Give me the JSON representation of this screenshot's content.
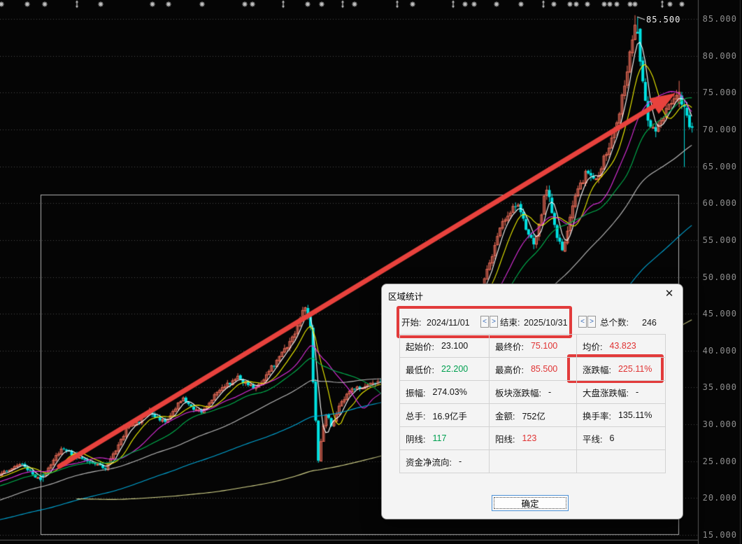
{
  "chart_data": {
    "type": "candlestick",
    "title": "daily K-line chart with area statistics selection",
    "y_axis": {
      "ticks": [
        "85.000",
        "80.000",
        "75.000",
        "70.000",
        "65.000",
        "60.000",
        "55.000",
        "50.000",
        "45.000",
        "40.000",
        "35.000",
        "30.000",
        "25.000",
        "20.000",
        "15.000"
      ],
      "min": 15,
      "max": 85
    },
    "peak_annotation": "85.500",
    "selection": {
      "start_date": "2024/11/01",
      "end_date": "2025/10/31",
      "bar_count": 246,
      "start_price": "23.100",
      "final_price": "75.100",
      "low": "22.200",
      "high": "85.500",
      "avg": "43.823",
      "change_pct": "225.11%"
    },
    "moving_averages": [
      {
        "period": 5,
        "color": "#ffffff"
      },
      {
        "period": 10,
        "color": "#f0f000"
      },
      {
        "period": 20,
        "color": "#e030e0"
      },
      {
        "period": 30,
        "color": "#00b450"
      },
      {
        "period": 60,
        "color": "#bebebe"
      },
      {
        "period": 120,
        "color": "#00a8d8"
      },
      {
        "period": 250,
        "color": "#d6d68c"
      }
    ],
    "prehistory_anchors": [
      [
        -220,
        26.5
      ],
      [
        -185,
        25
      ],
      [
        -150,
        20
      ],
      [
        -130,
        15
      ],
      [
        -110,
        13.5
      ],
      [
        -80,
        14.5
      ],
      [
        -50,
        17
      ],
      [
        -25,
        20.5
      ]
    ],
    "price_path_anchors": [
      [
        0,
        23.3
      ],
      [
        4,
        24.2
      ],
      [
        8,
        24.6
      ],
      [
        12,
        23.2
      ],
      [
        15,
        22.5
      ],
      [
        19,
        24.5
      ],
      [
        23,
        26.8
      ],
      [
        27,
        26
      ],
      [
        31,
        25.3
      ],
      [
        36,
        24.8
      ],
      [
        40,
        24.1
      ],
      [
        44,
        26.5
      ],
      [
        48,
        29.3
      ],
      [
        53,
        30.5
      ],
      [
        57,
        31.8
      ],
      [
        60,
        30.8
      ],
      [
        63,
        30.4
      ],
      [
        66,
        31.8
      ],
      [
        70,
        33.6
      ],
      [
        73,
        32.3
      ],
      [
        77,
        31.6
      ],
      [
        80,
        33
      ],
      [
        84,
        34.8
      ],
      [
        88,
        35.6
      ],
      [
        91,
        36.3
      ],
      [
        95,
        35.4
      ],
      [
        98,
        34.9
      ],
      [
        102,
        36.8
      ],
      [
        106,
        38.6
      ],
      [
        110,
        40.5
      ],
      [
        113,
        42.5
      ],
      [
        116,
        45.5
      ],
      [
        117,
        46.2
      ],
      [
        119,
        43
      ],
      [
        120,
        35.5
      ],
      [
        121,
        30.5
      ],
      [
        122,
        25.2
      ],
      [
        123,
        27.5
      ],
      [
        124,
        30
      ],
      [
        125,
        31.5
      ],
      [
        127,
        29.8
      ],
      [
        130,
        32.5
      ],
      [
        134,
        34.5
      ],
      [
        138,
        35
      ],
      [
        141,
        35.5
      ],
      [
        145,
        35.8
      ],
      [
        148,
        36.2
      ],
      [
        151,
        35
      ],
      [
        154,
        34.6
      ],
      [
        158,
        36
      ],
      [
        161,
        38.3
      ],
      [
        165,
        40
      ],
      [
        168,
        42
      ],
      [
        172,
        43.5
      ],
      [
        175,
        44.5
      ],
      [
        179,
        46
      ],
      [
        182,
        47
      ],
      [
        185,
        48.5
      ],
      [
        188,
        52
      ],
      [
        191,
        55.5
      ],
      [
        194,
        58
      ],
      [
        197,
        59.5
      ],
      [
        199,
        59.8
      ],
      [
        202,
        56.5
      ],
      [
        205,
        54.5
      ],
      [
        207,
        57
      ],
      [
        210,
        62.3
      ],
      [
        212,
        58.5
      ],
      [
        214,
        55.5
      ],
      [
        216,
        53.5
      ],
      [
        219,
        58
      ],
      [
        222,
        62
      ],
      [
        226,
        64.5
      ],
      [
        229,
        63
      ],
      [
        233,
        67
      ],
      [
        237,
        70.5
      ],
      [
        240,
        76
      ],
      [
        242,
        80.5
      ],
      [
        244,
        84
      ],
      [
        245,
        83
      ],
      [
        247,
        76
      ],
      [
        249,
        71.5
      ],
      [
        252,
        69.5
      ],
      [
        255,
        71.5
      ],
      [
        258,
        74
      ],
      [
        261,
        75.1
      ],
      [
        263,
        72.5
      ],
      [
        266,
        69.8
      ]
    ],
    "event_markers": {
      "asterisk_x": [
        2,
        39,
        64,
        144,
        218,
        241,
        289,
        350,
        361,
        440,
        460,
        507,
        590,
        665,
        678,
        710,
        745,
        792,
        815,
        824,
        840,
        864,
        872,
        882,
        901,
        908,
        958,
        975
      ],
      "updown_x": [
        110,
        405,
        490,
        568,
        648,
        777,
        947
      ]
    },
    "colors": {
      "up": "#ef6e5a",
      "down": "#00e2e2",
      "grid": "#4a4a4a",
      "axis_text": "#8f8f8f",
      "arrow": "#e8423d",
      "selection_box": "#b4b4b4"
    }
  },
  "dialog": {
    "title": "区域统计",
    "close_glyph": "✕",
    "date_row": {
      "start_label": "开始:",
      "start_value": "2024/11/01",
      "end_label": "结束:",
      "end_value": "2025/10/31",
      "count_label": "总个数:",
      "count_value": "246",
      "spin_left": "<",
      "spin_right": ">"
    },
    "rows": [
      [
        {
          "label": "起始价:",
          "value": "23.100",
          "c": "k"
        },
        {
          "label": "最终价:",
          "value": "75.100",
          "c": "r"
        },
        {
          "label": "均价:",
          "value": "43.823",
          "c": "r"
        }
      ],
      [
        {
          "label": "最低价:",
          "value": "22.200",
          "c": "g"
        },
        {
          "label": "最高价:",
          "value": "85.500",
          "c": "r"
        },
        {
          "label": "涨跌幅:",
          "value": "225.11%",
          "c": "r"
        }
      ],
      [
        {
          "label": "振幅:",
          "value": "274.03%",
          "c": "k"
        },
        {
          "label": "板块涨跌幅:",
          "value": "-",
          "c": "k"
        },
        {
          "label": "大盘涨跌幅:",
          "value": "-",
          "c": "k"
        }
      ],
      [
        {
          "label": "总手:",
          "value": "16.9亿手",
          "c": "k"
        },
        {
          "label": "金额:",
          "value": "752亿",
          "c": "k"
        },
        {
          "label": "换手率:",
          "value": "135.11%",
          "c": "k"
        }
      ],
      [
        {
          "label": "阴线:",
          "value": "117",
          "c": "g"
        },
        {
          "label": "阳线:",
          "value": "123",
          "c": "r"
        },
        {
          "label": "平线:",
          "value": "6",
          "c": "k"
        }
      ],
      [
        {
          "label": "资金净流向:",
          "value": "-",
          "c": "k"
        },
        {
          "label": "",
          "value": "",
          "c": "k"
        },
        {
          "label": "",
          "value": "",
          "c": "k"
        }
      ]
    ],
    "ok_label": "确定"
  }
}
